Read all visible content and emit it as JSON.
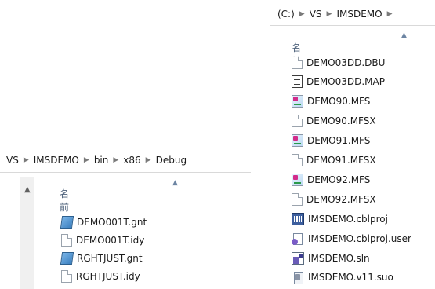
{
  "left_pane": {
    "breadcrumb": [
      "VS",
      "IMSDEMO",
      "bin",
      "x86",
      "Debug"
    ],
    "column_header": "名前",
    "files": [
      {
        "name": "DEMO001T.gnt",
        "icon": "gnt-file-icon"
      },
      {
        "name": "DEMO001T.idy",
        "icon": "blank-file-icon"
      },
      {
        "name": "RGHTJUST.gnt",
        "icon": "gnt-file-icon"
      },
      {
        "name": "RGHTJUST.idy",
        "icon": "blank-file-icon"
      }
    ]
  },
  "right_pane": {
    "breadcrumb": [
      "(C:)",
      "VS",
      "IMSDEMO"
    ],
    "column_header": "名前",
    "files": [
      {
        "name": "DEMO03DD.DBU",
        "icon": "blank-file-icon"
      },
      {
        "name": "DEMO03DD.MAP",
        "icon": "text-file-icon"
      },
      {
        "name": "DEMO90.MFS",
        "icon": "mfs-file-icon"
      },
      {
        "name": "DEMO90.MFSX",
        "icon": "blank-file-icon"
      },
      {
        "name": "DEMO91.MFS",
        "icon": "mfs-file-icon"
      },
      {
        "name": "DEMO91.MFSX",
        "icon": "blank-file-icon"
      },
      {
        "name": "DEMO92.MFS",
        "icon": "mfs-file-icon"
      },
      {
        "name": "DEMO92.MFSX",
        "icon": "blank-file-icon"
      },
      {
        "name": "IMSDEMO.cblproj",
        "icon": "cobol-project-icon"
      },
      {
        "name": "IMSDEMO.cblproj.user",
        "icon": "user-settings-file-icon"
      },
      {
        "name": "IMSDEMO.sln",
        "icon": "solution-file-icon"
      },
      {
        "name": "IMSDEMO.v11.suo",
        "icon": "suo-file-icon"
      }
    ]
  }
}
